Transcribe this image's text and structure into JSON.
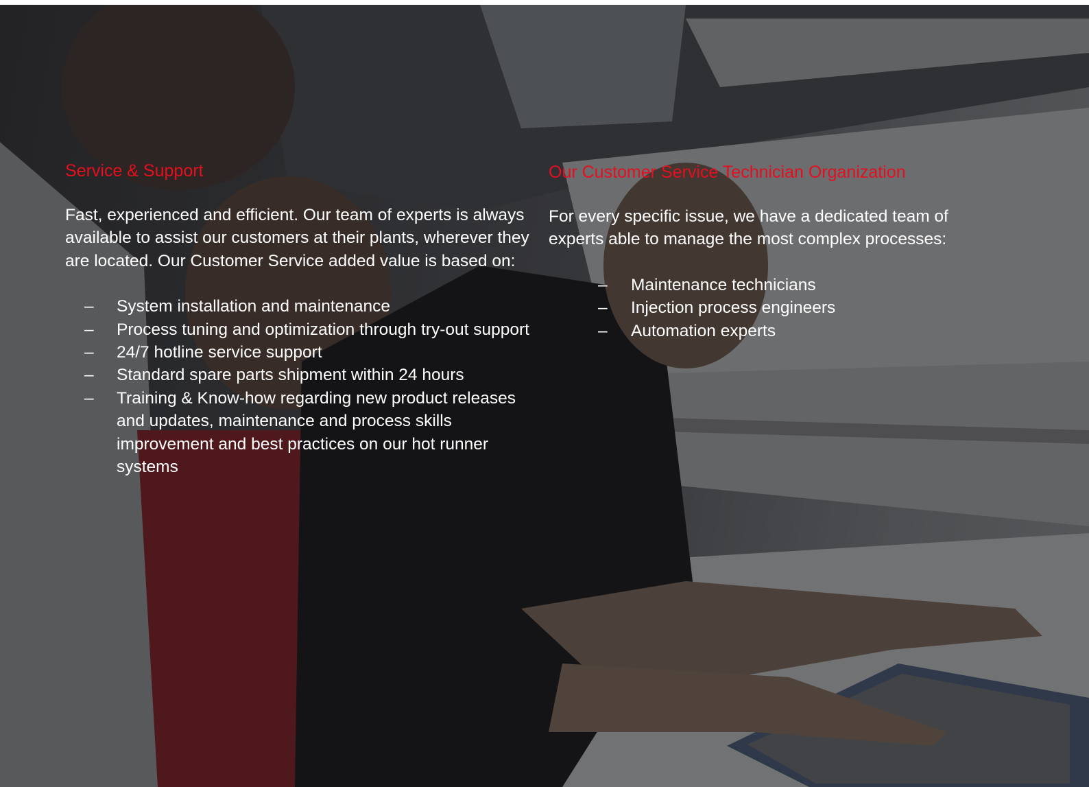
{
  "left_column": {
    "heading": "Service & Support",
    "intro": "Fast, experienced and efficient. Our team of experts is always available to assist our customers at their plants, wherever they are located. Our Customer Service added value is based on:",
    "bullet_marker": "–",
    "items": [
      "System installation and maintenance",
      "Process tuning and optimization through try-out support",
      "24/7 hotline service support",
      "Standard spare parts shipment within 24 hours",
      "Training & Know-how regarding new product releases and updates, maintenance and process skills improvement and best practices on our hot runner systems"
    ]
  },
  "right_column": {
    "heading": "Our Customer Service Technician Organization",
    "intro": "For every specific issue, we have a dedicated team of experts able to manage the most complex processes:",
    "bullet_marker": "–",
    "items": [
      "Maintenance technicians",
      "Injection process engineers",
      "Automation experts"
    ]
  },
  "colors": {
    "heading": "#e3101f",
    "body_text": "#ffffff"
  }
}
